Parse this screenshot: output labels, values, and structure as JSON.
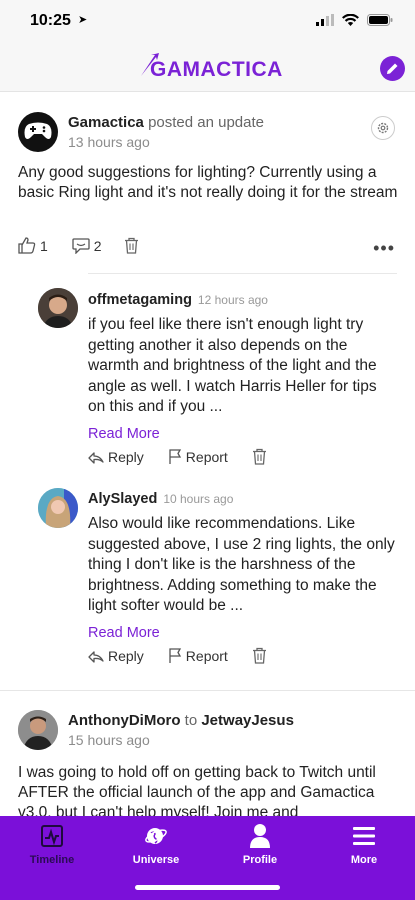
{
  "status_bar": {
    "time": "10:25"
  },
  "header": {
    "logo_text": "GAMACTICA",
    "compose_icon": "pencil-icon"
  },
  "post1": {
    "author": "Gamactica",
    "action": "posted an update",
    "time": "13 hours ago",
    "text": "Any good suggestions for lighting? Currently using a basic Ring light and it's not really doing it for the stream",
    "likes": "1",
    "comments": "2"
  },
  "replies": [
    {
      "name": "offmetagaming",
      "time": "12 hours ago",
      "text": "if you feel like there isn't enough light try getting another it also depends on the warmth and brightness of the light and the angle as well. I watch Harris Heller for tips on this and if you ...",
      "read_more": "Read More",
      "reply_label": "Reply",
      "report_label": "Report"
    },
    {
      "name": "AlySlayed",
      "time": "10 hours ago",
      "text": "Also would like recommendations. Like suggested above, I use 2 ring lights, the only thing I don't like is the harshness of the brightness. Adding something to make the light softer would be ...",
      "read_more": "Read More",
      "reply_label": "Reply",
      "report_label": "Report"
    }
  ],
  "post2": {
    "author": "AnthonyDiMoro",
    "connector": "to",
    "recipient": "JetwayJesus",
    "time": "15 hours ago",
    "text": "I was going to hold off on getting back to Twitch until AFTER the official launch of the app and Gamactica v3.0, but I can't help myself! Join me and"
  },
  "tabs": [
    {
      "label": "Timeline",
      "icon": "timeline-icon"
    },
    {
      "label": "Universe",
      "icon": "universe-icon"
    },
    {
      "label": "Profile",
      "icon": "profile-icon"
    },
    {
      "label": "More",
      "icon": "menu-icon"
    }
  ],
  "colors": {
    "brand": "#7b22d6",
    "tab_bar": "#7b10d9"
  }
}
